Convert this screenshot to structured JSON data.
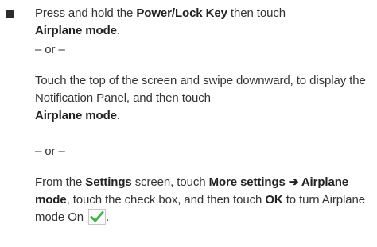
{
  "steps": {
    "option1": {
      "t1": "Press and hold the ",
      "b1": "Power/Lock Key",
      "t2": " then touch ",
      "b2": "Airplane mode",
      "t3": "."
    },
    "separator1": "– or –",
    "option2": {
      "t1": "Touch the top of the screen and swipe downward, to display the Notification Panel, and then touch ",
      "b1": "Airplane mode",
      "t2": "."
    },
    "separator2": "– or –",
    "option3": {
      "t1": "From the ",
      "b1": "Settings",
      "t2": " screen, touch ",
      "b2": "More settings ➔ Airplane mode",
      "t3": ", touch the check box, and then touch ",
      "b3": "OK",
      "t4": " to turn Airplane mode On ",
      "t5": "."
    }
  },
  "icons": {
    "bullet": "square-bullet-icon",
    "checkbox": "checked-checkbox-icon"
  },
  "colors": {
    "text": "#333333",
    "check_green": "#4caf50"
  }
}
